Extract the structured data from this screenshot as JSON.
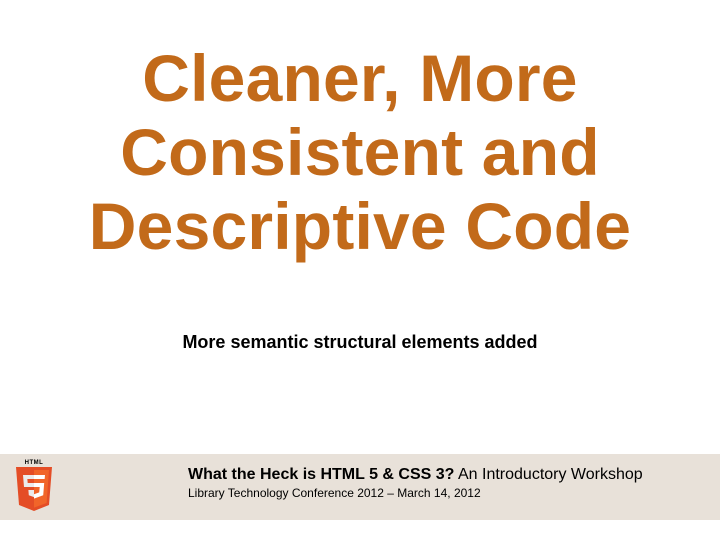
{
  "title": "Cleaner, More Consistent and Descriptive Code",
  "subtitle": "More semantic structural elements added",
  "footer": {
    "logo_label": "HTML",
    "line1_bold": "What the Heck is HTML 5 & CSS 3?",
    "line1_rest": "  An Introductory Workshop",
    "line2": "Library Technology Conference 2012 – March 14, 2012"
  },
  "colors": {
    "accent": "#c26a1a",
    "band": "#e8e1d9",
    "shield_outer": "#e44d26",
    "shield_inner": "#f16529"
  }
}
